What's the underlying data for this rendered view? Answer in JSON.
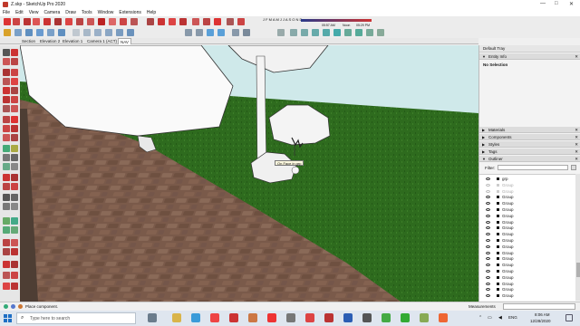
{
  "window": {
    "title": "Z.skp - SketchUp Pro 2020",
    "minimize": "—",
    "maximize": "□",
    "close": "✕"
  },
  "menu": [
    "File",
    "Edit",
    "View",
    "Camera",
    "Draw",
    "Tools",
    "Window",
    "Extensions",
    "Help"
  ],
  "shadow_bar": {
    "months": "J F M A M J J A S O N D",
    "time_start": "05:57 AM",
    "time_noon": "Noon",
    "time_end": "05:29 PM"
  },
  "scene_tabs": [
    "Section",
    "Elevation 2",
    "Elevation 1",
    "Camera 1 (ACT)",
    "NAV"
  ],
  "active_tab_index": 4,
  "viewport": {
    "tooltip": "On Face in grp"
  },
  "tray": {
    "title": "Default Tray",
    "entity_info": {
      "header": "Entity Info",
      "value": "No Selection"
    },
    "panels": [
      "Materials",
      "Components",
      "Styles",
      "Tags",
      "Outliner"
    ],
    "outliner": {
      "filter_label": "Filter:",
      "rows": [
        {
          "label": "grp",
          "faded": false
        },
        {
          "label": "Group",
          "faded": true
        },
        {
          "label": "Group",
          "faded": true
        },
        {
          "label": "Group",
          "faded": false
        },
        {
          "label": "Group",
          "faded": false
        },
        {
          "label": "Group",
          "faded": false
        },
        {
          "label": "Group",
          "faded": false
        },
        {
          "label": "Group",
          "faded": false
        },
        {
          "label": "Group",
          "faded": false
        },
        {
          "label": "Group",
          "faded": false
        },
        {
          "label": "Group",
          "faded": false
        },
        {
          "label": "Group",
          "faded": false
        },
        {
          "label": "Group",
          "faded": false
        },
        {
          "label": "Group",
          "faded": false
        },
        {
          "label": "Group",
          "faded": false
        },
        {
          "label": "Group",
          "faded": false
        },
        {
          "label": "Group",
          "faded": false
        },
        {
          "label": "Group",
          "faded": false
        },
        {
          "label": "Group",
          "faded": false
        },
        {
          "label": "Group",
          "faded": false
        },
        {
          "label": "Group",
          "faded": false
        }
      ]
    }
  },
  "status": {
    "message": "Place component.",
    "measurements_label": "Measurements"
  },
  "taskbar": {
    "search_placeholder": "Type here to search",
    "lang": "ENG",
    "time": "8:06 AM",
    "date": "12/28/2020"
  },
  "colors": {
    "grass": "#2e6b1e",
    "sky": "#cfe9ea",
    "paving": "#7a5a4a",
    "taskbar": "#dfe6ef"
  }
}
